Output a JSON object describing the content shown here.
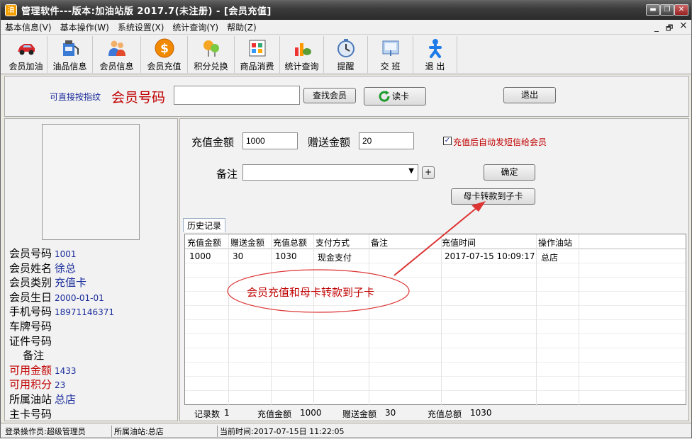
{
  "window": {
    "title": "管理软件---版本:加油站版  2017.7(未注册) - [会员充值]",
    "icon": "app-icon",
    "min": "▬",
    "max": "❐",
    "close": "✕"
  },
  "menu": [
    "基本信息(V)",
    "基本操作(W)",
    "系统设置(X)",
    "统计查询(Y)",
    "帮助(Z)"
  ],
  "mdi": {
    "min": "_",
    "restore": "🗗",
    "close": "×"
  },
  "toolbar": [
    {
      "label": "会员加油",
      "icon": "car-icon"
    },
    {
      "label": "油品信息",
      "icon": "oil-icon"
    },
    {
      "label": "会员信息",
      "icon": "users-icon"
    },
    {
      "label": "会员充值",
      "icon": "dollar-coin-icon"
    },
    {
      "label": "积分兑换",
      "icon": "points-icon"
    },
    {
      "label": "商品消费",
      "icon": "goods-icon"
    },
    {
      "label": "统计查询",
      "icon": "stats-icon"
    },
    {
      "label": "提醒",
      "icon": "clock-icon"
    },
    {
      "label": "交 班",
      "icon": "shift-icon"
    },
    {
      "label": "退 出",
      "icon": "exit-icon"
    }
  ],
  "search": {
    "fingerprint_hint": "可直接按指纹",
    "member_no_label": "会员号码",
    "member_no_value": "",
    "find_button": "查找会员",
    "read_card_button": "读卡",
    "exit_button": "退出"
  },
  "member": {
    "fields": [
      {
        "label": "会员号码",
        "value": "1001",
        "color": "#000"
      },
      {
        "label": "会员姓名",
        "value": "徐总",
        "color": "#000",
        "big": true
      },
      {
        "label": "会员类别",
        "value": "充值卡",
        "color": "#000",
        "big": true
      },
      {
        "label": "会员生日",
        "value": "2000-01-01",
        "color": "#000"
      },
      {
        "label": "手机号码",
        "value": "18971146371",
        "color": "#000"
      },
      {
        "label": "车牌号码",
        "value": "",
        "color": "#000"
      },
      {
        "label": "证件号码",
        "value": "",
        "color": "#000"
      },
      {
        "label": "    备注",
        "value": "",
        "color": "#000"
      },
      {
        "label": "可用金额",
        "value": "1433",
        "color": "#c00000"
      },
      {
        "label": "可用积分",
        "value": "23",
        "color": "#c00000"
      },
      {
        "label": "所属油站",
        "value": "总店",
        "color": "#000",
        "big": true
      },
      {
        "label": "主卡号码",
        "value": "",
        "color": "#000"
      }
    ]
  },
  "recharge": {
    "amount_label": "充值金额",
    "amount_value": "1000",
    "bonus_label": "赠送金额",
    "bonus_value": "20",
    "sms_label": "充值后自动发短信给会员",
    "sms_checked": true,
    "note_label": "备注",
    "note_value": "",
    "plus": "+",
    "confirm_button": "确定",
    "transfer_button": "母卡转款到子卡"
  },
  "history": {
    "tab": "历史记录",
    "columns": [
      "充值金额",
      "赠送金额",
      "充值总额",
      "支付方式",
      "备注",
      "充值时间",
      "操作油站"
    ],
    "rows": [
      [
        "1000",
        "30",
        "1030",
        "现金支付",
        "",
        "2017-07-15 10:09:17",
        "总店"
      ]
    ]
  },
  "summary": {
    "count_label": "记录数",
    "count": "1",
    "amount_label": "充值金额",
    "amount": "1000",
    "bonus_label": "赠送金额",
    "bonus": "30",
    "total_label": "充值总额",
    "total": "1030"
  },
  "annotation": "会员充值和母卡转款到子卡",
  "status": {
    "operator": "登录操作员:超级管理员",
    "station": "所属油站:总店",
    "time": "当前时间:2017-07-15日 11:22:05"
  }
}
